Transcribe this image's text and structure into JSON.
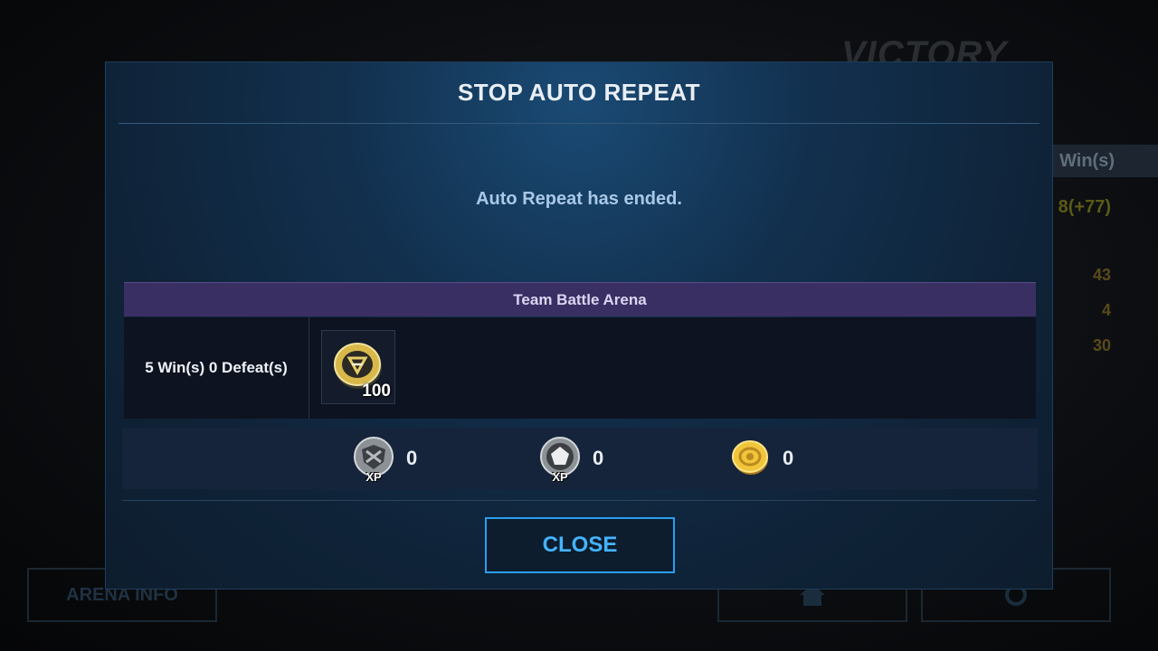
{
  "background": {
    "victory": "VICTORY",
    "wins_label": "Win(s)",
    "points": "8(+77)",
    "stats": [
      "43",
      "4",
      "30"
    ],
    "arena_info_button": "ARENA INFO"
  },
  "modal": {
    "title": "STOP AUTO REPEAT",
    "message": "Auto Repeat has ended.",
    "section_title": "Team Battle Arena",
    "record": "5 Win(s) 0 Defeat(s)",
    "reward": {
      "icon": "arena-coin-icon",
      "count": "100"
    },
    "xp_stats": [
      {
        "icon": "shield-xp-icon",
        "tag": "XP",
        "value": "0"
      },
      {
        "icon": "pentagon-xp-icon",
        "tag": "XP",
        "value": "0"
      },
      {
        "icon": "gold-coin-icon",
        "value": "0"
      }
    ],
    "close_label": "CLOSE"
  },
  "colors": {
    "accent": "#45b4ff",
    "header_bg": "#3a2f63",
    "modal_bg": "#12304e"
  }
}
